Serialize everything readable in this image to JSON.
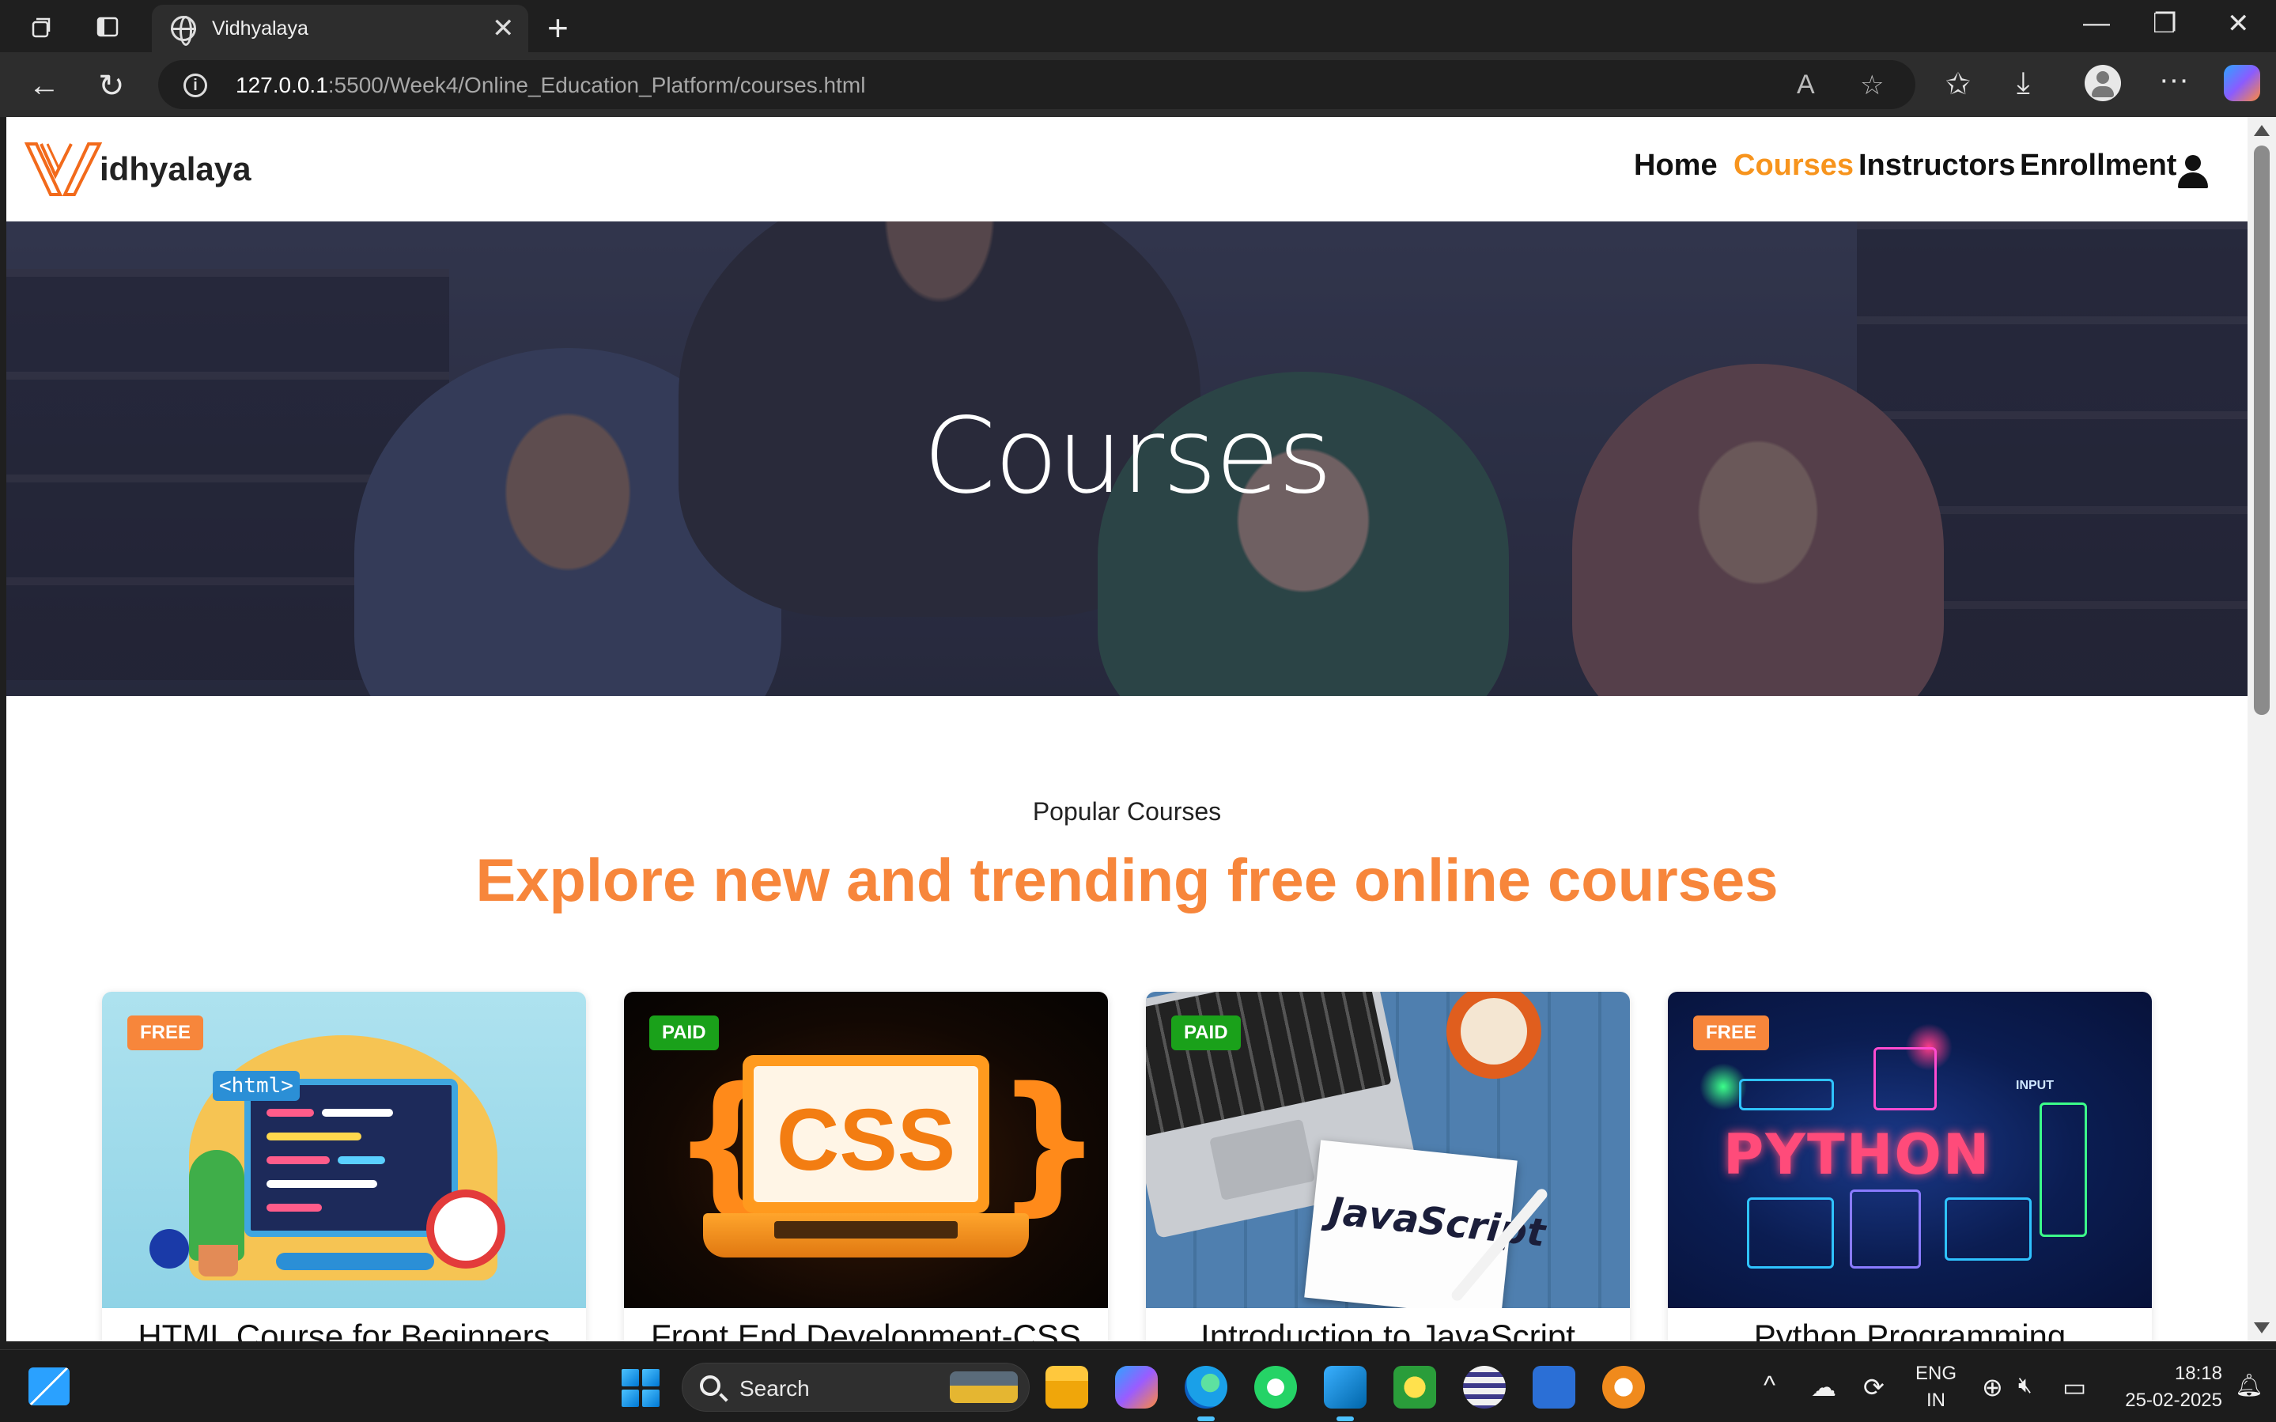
{
  "browser": {
    "tab_title": "Vidhyalaya",
    "url_host": "127.0.0.1",
    "url_rest": ":5500/Week4/Online_Education_Platform/courses.html",
    "close_glyph": "✕",
    "newtab_glyph": "+",
    "min_glyph": "—",
    "restore_glyph": "❐",
    "winclose_glyph": "✕",
    "back_glyph": "←",
    "reload_glyph": "↻",
    "read_aloud_glyph": "A",
    "favorite_glyph": "☆",
    "favorites_glyph": "✩",
    "download_glyph": "⤓",
    "more_glyph": "···"
  },
  "site": {
    "brand_text": "idhyalaya",
    "brand_color": "#f26a1b",
    "nav": [
      {
        "label": "Home",
        "active": false
      },
      {
        "label": "Courses",
        "active": true
      },
      {
        "label": "Instructors",
        "active": false
      },
      {
        "label": "Enrollment",
        "active": false
      }
    ],
    "accent": "#f7941d"
  },
  "hero": {
    "title": "Courses"
  },
  "section": {
    "eyebrow": "Popular Courses",
    "heading": "Explore new and trending free online courses",
    "heading_color": "#f7863b"
  },
  "courses": [
    {
      "badge": "FREE",
      "title": "HTML Course for Beginners",
      "image_text": "<html>"
    },
    {
      "badge": "PAID",
      "title": "Front End Development-CSS",
      "image_text": "CSS"
    },
    {
      "badge": "PAID",
      "title": "Introduction to JavaScript",
      "image_text": "JavaScript"
    },
    {
      "badge": "FREE",
      "title": "Python Programming",
      "image_text": "PYTHON",
      "image_label": "INPUT"
    }
  ],
  "taskbar": {
    "search_label": "Search",
    "lang_top": "ENG",
    "lang_bottom": "IN",
    "time": "18:18",
    "date": "25-02-2025",
    "chevron_glyph": "^",
    "cloud_glyph": "☁",
    "sync_glyph": "⟳",
    "globe_glyph": "⊕",
    "mute_glyph": "🔇︎",
    "battery_glyph": "▭",
    "notify_glyph": "🔔︎"
  }
}
